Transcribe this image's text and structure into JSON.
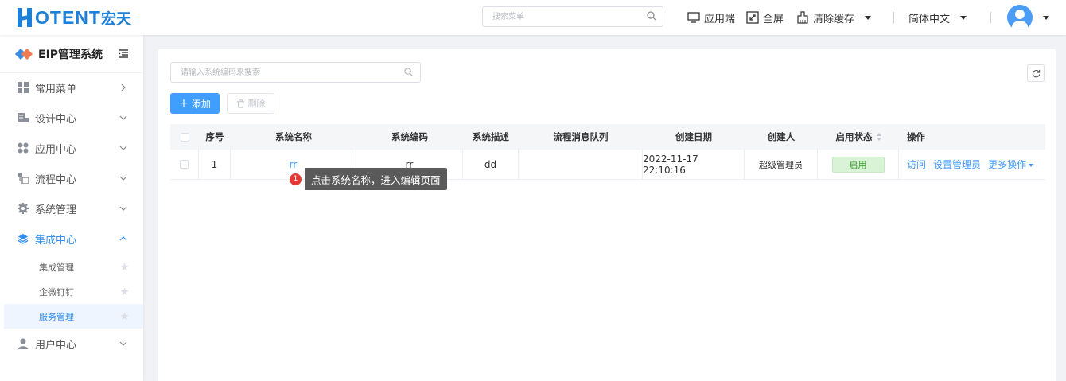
{
  "header": {
    "logo_text": "OTENT",
    "logo_cn": "宏天",
    "search_placeholder": "搜索菜单",
    "app_end": "应用端",
    "fullscreen": "全屏",
    "clear_cache": "清除缓存",
    "language": "简体中文"
  },
  "sidebar": {
    "title": "EIP管理系统",
    "items": [
      {
        "label": "常用菜单"
      },
      {
        "label": "设计中心"
      },
      {
        "label": "应用中心"
      },
      {
        "label": "流程中心"
      },
      {
        "label": "系统管理"
      },
      {
        "label": "集成中心"
      },
      {
        "label": "用户中心"
      }
    ],
    "sub_items": [
      {
        "label": "集成管理"
      },
      {
        "label": "企微钉钉"
      },
      {
        "label": "服务管理"
      }
    ],
    "accent_color": "#2f8ef0"
  },
  "toolbar": {
    "search_placeholder": "请输入系统编码来搜索",
    "add_label": "添加",
    "delete_label": "删除"
  },
  "table": {
    "columns": {
      "index": "序号",
      "name": "系统名称",
      "code": "系统编码",
      "desc": "系统描述",
      "queue": "流程消息队列",
      "created": "创建日期",
      "creator": "创建人",
      "status": "启用状态",
      "ops": "操作"
    },
    "rows": [
      {
        "index": "1",
        "name": "rr",
        "code": "rr",
        "desc": "dd",
        "queue": "",
        "created": "2022-11-17 22:10:16",
        "creator": "超级管理员",
        "status": "启用",
        "op_visit": "访问",
        "op_admin": "设置管理员",
        "op_more": "更多操作"
      }
    ]
  },
  "tooltip": {
    "step": "1",
    "text": "点击系统名称，进入编辑页面"
  }
}
